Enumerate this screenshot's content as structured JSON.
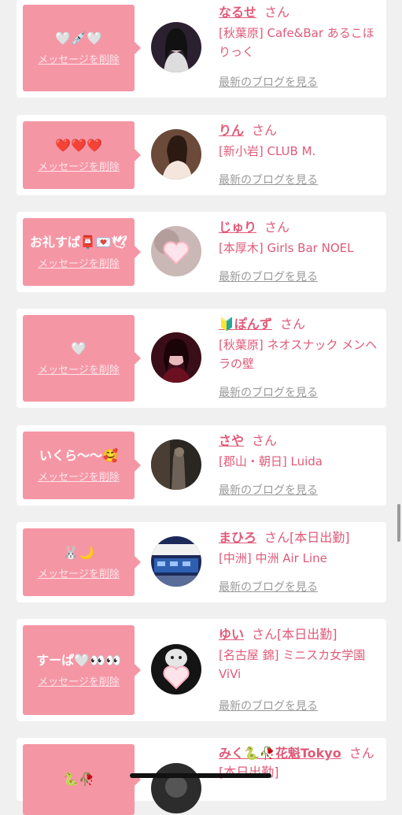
{
  "delete_label": "メッセージを削除",
  "blog_label": "最新のブログを見る",
  "san_label": "さん",
  "colors": {
    "background": "#f0f0f0",
    "bubble": "#f596a5",
    "name": "#e05a79",
    "link_gray": "#9a9a9a"
  },
  "cards": [
    {
      "message": "🤍💉🤍",
      "name": "なるせ",
      "suffix": "",
      "shop": "[秋葉原] Cafe&Bar あるこほりっく",
      "avatar": "avatar-photo"
    },
    {
      "message": "❤️❤️❤️",
      "name": "りん",
      "suffix": "",
      "shop": "[新小岩] CLUB M.",
      "avatar": "avatar-photo"
    },
    {
      "message": "お礼すぱ📮💌🕊",
      "name": "じゅり",
      "suffix": "",
      "shop": "[本厚木] Girls Bar NOEL",
      "avatar": "avatar-heart"
    },
    {
      "message": "🤍",
      "name": "🔰ぽんず",
      "suffix": "",
      "shop": "[秋葉原] ネオスナック メンヘラの壁",
      "avatar": "avatar-photo"
    },
    {
      "message": "いくら〜〜🥰",
      "name": "さや",
      "suffix": "",
      "shop": "[郡山・朝日] Luida",
      "avatar": "avatar-photo"
    },
    {
      "message": "🐰🌙",
      "name": "まひろ",
      "suffix": "[本日出勤]",
      "shop": "[中洲] 中洲 Air Line",
      "avatar": "avatar-photo"
    },
    {
      "message": "すーぱ🤍👀👀",
      "name": "ゆい",
      "suffix": "[本日出勤]",
      "shop": "[名古屋 錦] ミニスカ女学園ViVi",
      "avatar": "avatar-heart"
    },
    {
      "message": "🐍🥀",
      "name": "みく🐍🥀花魁Tokyo",
      "suffix": "[本日出勤]",
      "shop": "",
      "avatar": "avatar-photo"
    }
  ]
}
